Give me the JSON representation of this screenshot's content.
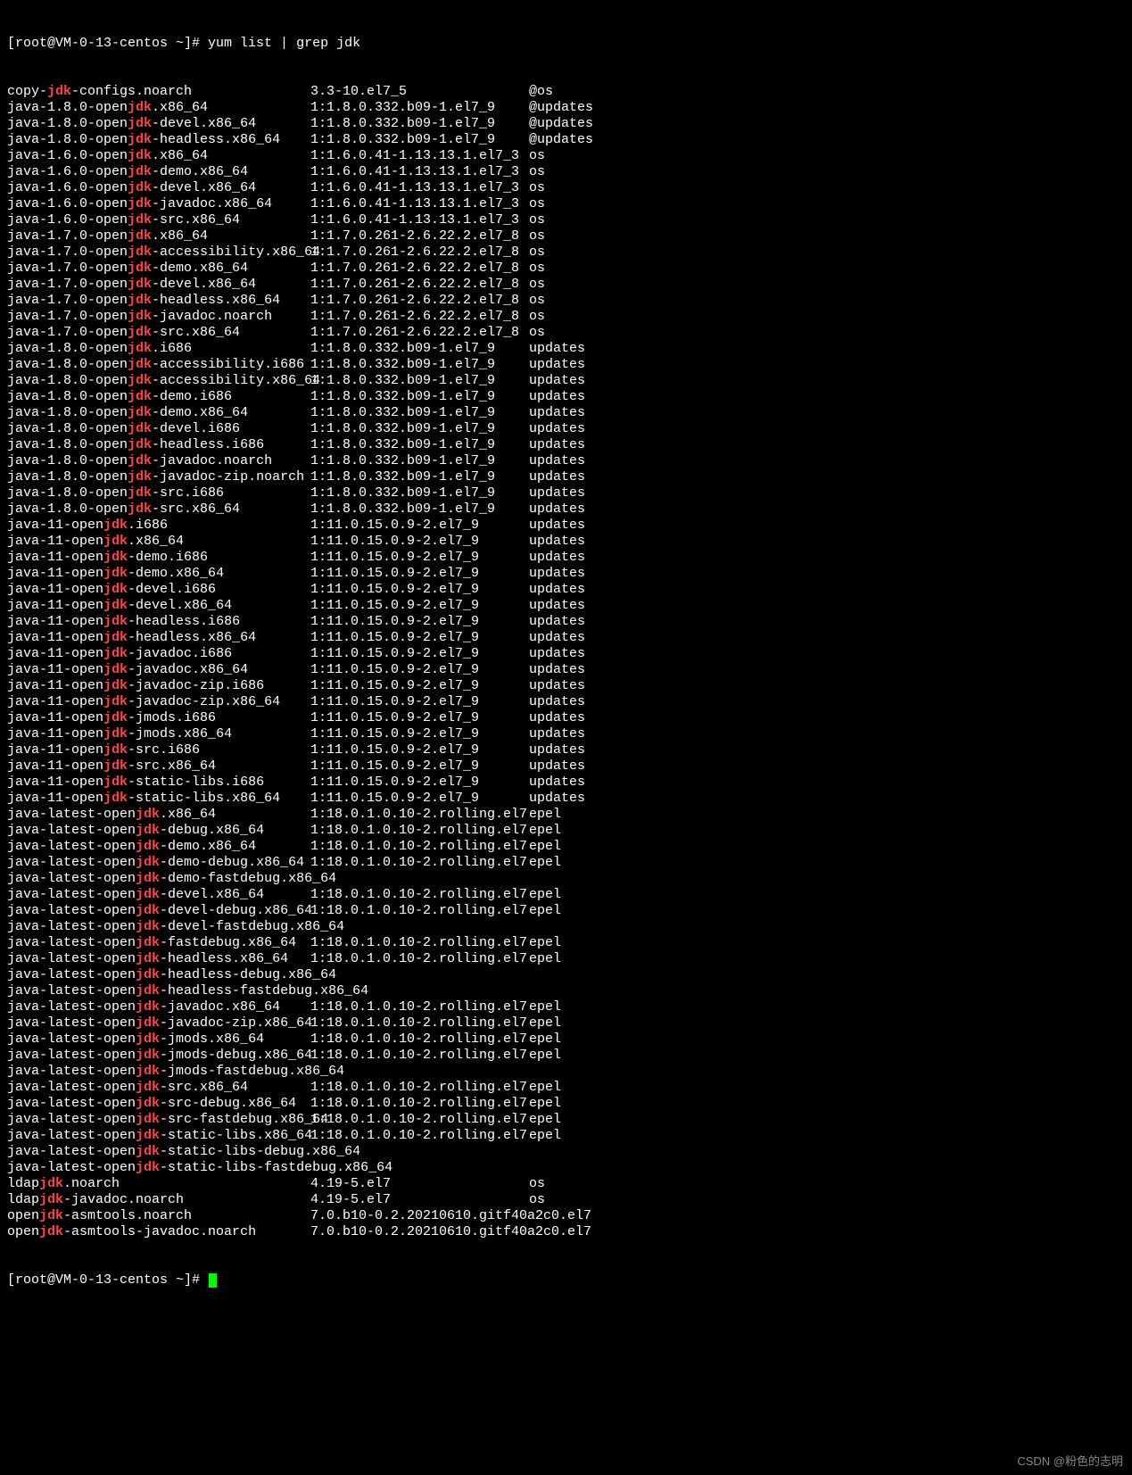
{
  "prompt1": "[root@VM-0-13-centos ~]# ",
  "command": "yum list | grep jdk",
  "prompt2": "[root@VM-0-13-centos ~]# ",
  "highlight": "jdk",
  "watermark": "CSDN @粉色的志明",
  "rows": [
    {
      "pre": "copy-",
      "post": "-configs.noarch",
      "ver": "3.3-10.el7_5",
      "repo": "@os"
    },
    {
      "pre": "java-1.8.0-open",
      "post": ".x86_64",
      "ver": "1:1.8.0.332.b09-1.el7_9",
      "repo": "@updates"
    },
    {
      "pre": "java-1.8.0-open",
      "post": "-devel.x86_64",
      "ver": "1:1.8.0.332.b09-1.el7_9",
      "repo": "@updates"
    },
    {
      "pre": "java-1.8.0-open",
      "post": "-headless.x86_64",
      "ver": "1:1.8.0.332.b09-1.el7_9",
      "repo": "@updates"
    },
    {
      "pre": "java-1.6.0-open",
      "post": ".x86_64",
      "ver": "1:1.6.0.41-1.13.13.1.el7_3",
      "repo": "os"
    },
    {
      "pre": "java-1.6.0-open",
      "post": "-demo.x86_64",
      "ver": "1:1.6.0.41-1.13.13.1.el7_3",
      "repo": "os"
    },
    {
      "pre": "java-1.6.0-open",
      "post": "-devel.x86_64",
      "ver": "1:1.6.0.41-1.13.13.1.el7_3",
      "repo": "os"
    },
    {
      "pre": "java-1.6.0-open",
      "post": "-javadoc.x86_64",
      "ver": "1:1.6.0.41-1.13.13.1.el7_3",
      "repo": "os"
    },
    {
      "pre": "java-1.6.0-open",
      "post": "-src.x86_64",
      "ver": "1:1.6.0.41-1.13.13.1.el7_3",
      "repo": "os"
    },
    {
      "pre": "java-1.7.0-open",
      "post": ".x86_64",
      "ver": "1:1.7.0.261-2.6.22.2.el7_8",
      "repo": "os"
    },
    {
      "pre": "java-1.7.0-open",
      "post": "-accessibility.x86_64",
      "ver": "1:1.7.0.261-2.6.22.2.el7_8",
      "repo": "os"
    },
    {
      "pre": "java-1.7.0-open",
      "post": "-demo.x86_64",
      "ver": "1:1.7.0.261-2.6.22.2.el7_8",
      "repo": "os"
    },
    {
      "pre": "java-1.7.0-open",
      "post": "-devel.x86_64",
      "ver": "1:1.7.0.261-2.6.22.2.el7_8",
      "repo": "os"
    },
    {
      "pre": "java-1.7.0-open",
      "post": "-headless.x86_64",
      "ver": "1:1.7.0.261-2.6.22.2.el7_8",
      "repo": "os"
    },
    {
      "pre": "java-1.7.0-open",
      "post": "-javadoc.noarch",
      "ver": "1:1.7.0.261-2.6.22.2.el7_8",
      "repo": "os"
    },
    {
      "pre": "java-1.7.0-open",
      "post": "-src.x86_64",
      "ver": "1:1.7.0.261-2.6.22.2.el7_8",
      "repo": "os"
    },
    {
      "pre": "java-1.8.0-open",
      "post": ".i686",
      "ver": "1:1.8.0.332.b09-1.el7_9",
      "repo": "updates"
    },
    {
      "pre": "java-1.8.0-open",
      "post": "-accessibility.i686",
      "ver": "1:1.8.0.332.b09-1.el7_9",
      "repo": "updates"
    },
    {
      "pre": "java-1.8.0-open",
      "post": "-accessibility.x86_64",
      "ver": "1:1.8.0.332.b09-1.el7_9",
      "repo": "updates"
    },
    {
      "pre": "java-1.8.0-open",
      "post": "-demo.i686",
      "ver": "1:1.8.0.332.b09-1.el7_9",
      "repo": "updates"
    },
    {
      "pre": "java-1.8.0-open",
      "post": "-demo.x86_64",
      "ver": "1:1.8.0.332.b09-1.el7_9",
      "repo": "updates"
    },
    {
      "pre": "java-1.8.0-open",
      "post": "-devel.i686",
      "ver": "1:1.8.0.332.b09-1.el7_9",
      "repo": "updates"
    },
    {
      "pre": "java-1.8.0-open",
      "post": "-headless.i686",
      "ver": "1:1.8.0.332.b09-1.el7_9",
      "repo": "updates"
    },
    {
      "pre": "java-1.8.0-open",
      "post": "-javadoc.noarch",
      "ver": "1:1.8.0.332.b09-1.el7_9",
      "repo": "updates"
    },
    {
      "pre": "java-1.8.0-open",
      "post": "-javadoc-zip.noarch",
      "ver": "1:1.8.0.332.b09-1.el7_9",
      "repo": "updates"
    },
    {
      "pre": "java-1.8.0-open",
      "post": "-src.i686",
      "ver": "1:1.8.0.332.b09-1.el7_9",
      "repo": "updates"
    },
    {
      "pre": "java-1.8.0-open",
      "post": "-src.x86_64",
      "ver": "1:1.8.0.332.b09-1.el7_9",
      "repo": "updates"
    },
    {
      "pre": "java-11-open",
      "post": ".i686",
      "ver": "1:11.0.15.0.9-2.el7_9",
      "repo": "updates"
    },
    {
      "pre": "java-11-open",
      "post": ".x86_64",
      "ver": "1:11.0.15.0.9-2.el7_9",
      "repo": "updates"
    },
    {
      "pre": "java-11-open",
      "post": "-demo.i686",
      "ver": "1:11.0.15.0.9-2.el7_9",
      "repo": "updates"
    },
    {
      "pre": "java-11-open",
      "post": "-demo.x86_64",
      "ver": "1:11.0.15.0.9-2.el7_9",
      "repo": "updates"
    },
    {
      "pre": "java-11-open",
      "post": "-devel.i686",
      "ver": "1:11.0.15.0.9-2.el7_9",
      "repo": "updates"
    },
    {
      "pre": "java-11-open",
      "post": "-devel.x86_64",
      "ver": "1:11.0.15.0.9-2.el7_9",
      "repo": "updates"
    },
    {
      "pre": "java-11-open",
      "post": "-headless.i686",
      "ver": "1:11.0.15.0.9-2.el7_9",
      "repo": "updates"
    },
    {
      "pre": "java-11-open",
      "post": "-headless.x86_64",
      "ver": "1:11.0.15.0.9-2.el7_9",
      "repo": "updates"
    },
    {
      "pre": "java-11-open",
      "post": "-javadoc.i686",
      "ver": "1:11.0.15.0.9-2.el7_9",
      "repo": "updates"
    },
    {
      "pre": "java-11-open",
      "post": "-javadoc.x86_64",
      "ver": "1:11.0.15.0.9-2.el7_9",
      "repo": "updates"
    },
    {
      "pre": "java-11-open",
      "post": "-javadoc-zip.i686",
      "ver": "1:11.0.15.0.9-2.el7_9",
      "repo": "updates"
    },
    {
      "pre": "java-11-open",
      "post": "-javadoc-zip.x86_64",
      "ver": "1:11.0.15.0.9-2.el7_9",
      "repo": "updates"
    },
    {
      "pre": "java-11-open",
      "post": "-jmods.i686",
      "ver": "1:11.0.15.0.9-2.el7_9",
      "repo": "updates"
    },
    {
      "pre": "java-11-open",
      "post": "-jmods.x86_64",
      "ver": "1:11.0.15.0.9-2.el7_9",
      "repo": "updates"
    },
    {
      "pre": "java-11-open",
      "post": "-src.i686",
      "ver": "1:11.0.15.0.9-2.el7_9",
      "repo": "updates"
    },
    {
      "pre": "java-11-open",
      "post": "-src.x86_64",
      "ver": "1:11.0.15.0.9-2.el7_9",
      "repo": "updates"
    },
    {
      "pre": "java-11-open",
      "post": "-static-libs.i686",
      "ver": "1:11.0.15.0.9-2.el7_9",
      "repo": "updates"
    },
    {
      "pre": "java-11-open",
      "post": "-static-libs.x86_64",
      "ver": "1:11.0.15.0.9-2.el7_9",
      "repo": "updates"
    },
    {
      "pre": "java-latest-open",
      "post": ".x86_64",
      "ver": "1:18.0.1.0.10-2.rolling.el7",
      "repo": "epel"
    },
    {
      "pre": "java-latest-open",
      "post": "-debug.x86_64",
      "ver": "1:18.0.1.0.10-2.rolling.el7",
      "repo": "epel"
    },
    {
      "pre": "java-latest-open",
      "post": "-demo.x86_64",
      "ver": "1:18.0.1.0.10-2.rolling.el7",
      "repo": "epel"
    },
    {
      "pre": "java-latest-open",
      "post": "-demo-debug.x86_64",
      "ver": "1:18.0.1.0.10-2.rolling.el7",
      "repo": "epel"
    },
    {
      "pre": "java-latest-open",
      "post": "-demo-fastdebug.x86_64",
      "ver": "",
      "repo": ""
    },
    {
      "pre": "java-latest-open",
      "post": "-devel.x86_64",
      "ver": "1:18.0.1.0.10-2.rolling.el7",
      "repo": "epel"
    },
    {
      "pre": "java-latest-open",
      "post": "-devel-debug.x86_64",
      "ver": "1:18.0.1.0.10-2.rolling.el7",
      "repo": "epel"
    },
    {
      "pre": "java-latest-open",
      "post": "-devel-fastdebug.x86_64",
      "ver": "",
      "repo": ""
    },
    {
      "pre": "java-latest-open",
      "post": "-fastdebug.x86_64",
      "ver": "1:18.0.1.0.10-2.rolling.el7",
      "repo": "epel"
    },
    {
      "pre": "java-latest-open",
      "post": "-headless.x86_64",
      "ver": "1:18.0.1.0.10-2.rolling.el7",
      "repo": "epel"
    },
    {
      "pre": "java-latest-open",
      "post": "-headless-debug.x86_64",
      "ver": "",
      "repo": ""
    },
    {
      "pre": "java-latest-open",
      "post": "-headless-fastdebug.x86_64",
      "ver": "",
      "repo": ""
    },
    {
      "pre": "java-latest-open",
      "post": "-javadoc.x86_64",
      "ver": "1:18.0.1.0.10-2.rolling.el7",
      "repo": "epel"
    },
    {
      "pre": "java-latest-open",
      "post": "-javadoc-zip.x86_64",
      "ver": "1:18.0.1.0.10-2.rolling.el7",
      "repo": "epel"
    },
    {
      "pre": "java-latest-open",
      "post": "-jmods.x86_64",
      "ver": "1:18.0.1.0.10-2.rolling.el7",
      "repo": "epel"
    },
    {
      "pre": "java-latest-open",
      "post": "-jmods-debug.x86_64",
      "ver": "1:18.0.1.0.10-2.rolling.el7",
      "repo": "epel"
    },
    {
      "pre": "java-latest-open",
      "post": "-jmods-fastdebug.x86_64",
      "ver": "",
      "repo": ""
    },
    {
      "pre": "java-latest-open",
      "post": "-src.x86_64",
      "ver": "1:18.0.1.0.10-2.rolling.el7",
      "repo": "epel"
    },
    {
      "pre": "java-latest-open",
      "post": "-src-debug.x86_64",
      "ver": "1:18.0.1.0.10-2.rolling.el7",
      "repo": "epel"
    },
    {
      "pre": "java-latest-open",
      "post": "-src-fastdebug.x86_64",
      "ver": "1:18.0.1.0.10-2.rolling.el7",
      "repo": "epel"
    },
    {
      "pre": "java-latest-open",
      "post": "-static-libs.x86_64",
      "ver": "1:18.0.1.0.10-2.rolling.el7",
      "repo": "epel"
    },
    {
      "pre": "java-latest-open",
      "post": "-static-libs-debug.x86_64",
      "ver": "",
      "repo": ""
    },
    {
      "pre": "java-latest-open",
      "post": "-static-libs-fastdebug.x86_64",
      "ver": "",
      "repo": ""
    },
    {
      "pre": "ldap",
      "post": ".noarch",
      "ver": "4.19-5.el7",
      "repo": "os"
    },
    {
      "pre": "ldap",
      "post": "-javadoc.noarch",
      "ver": "4.19-5.el7",
      "repo": "os"
    },
    {
      "pre": "open",
      "post": "-asmtools.noarch",
      "ver": "7.0.b10-0.2.20210610.gitf40a2c0.el7",
      "repo": ""
    },
    {
      "pre": "open",
      "post": "-asmtools-javadoc.noarch",
      "ver": "7.0.b10-0.2.20210610.gitf40a2c0.el7",
      "repo": ""
    }
  ]
}
